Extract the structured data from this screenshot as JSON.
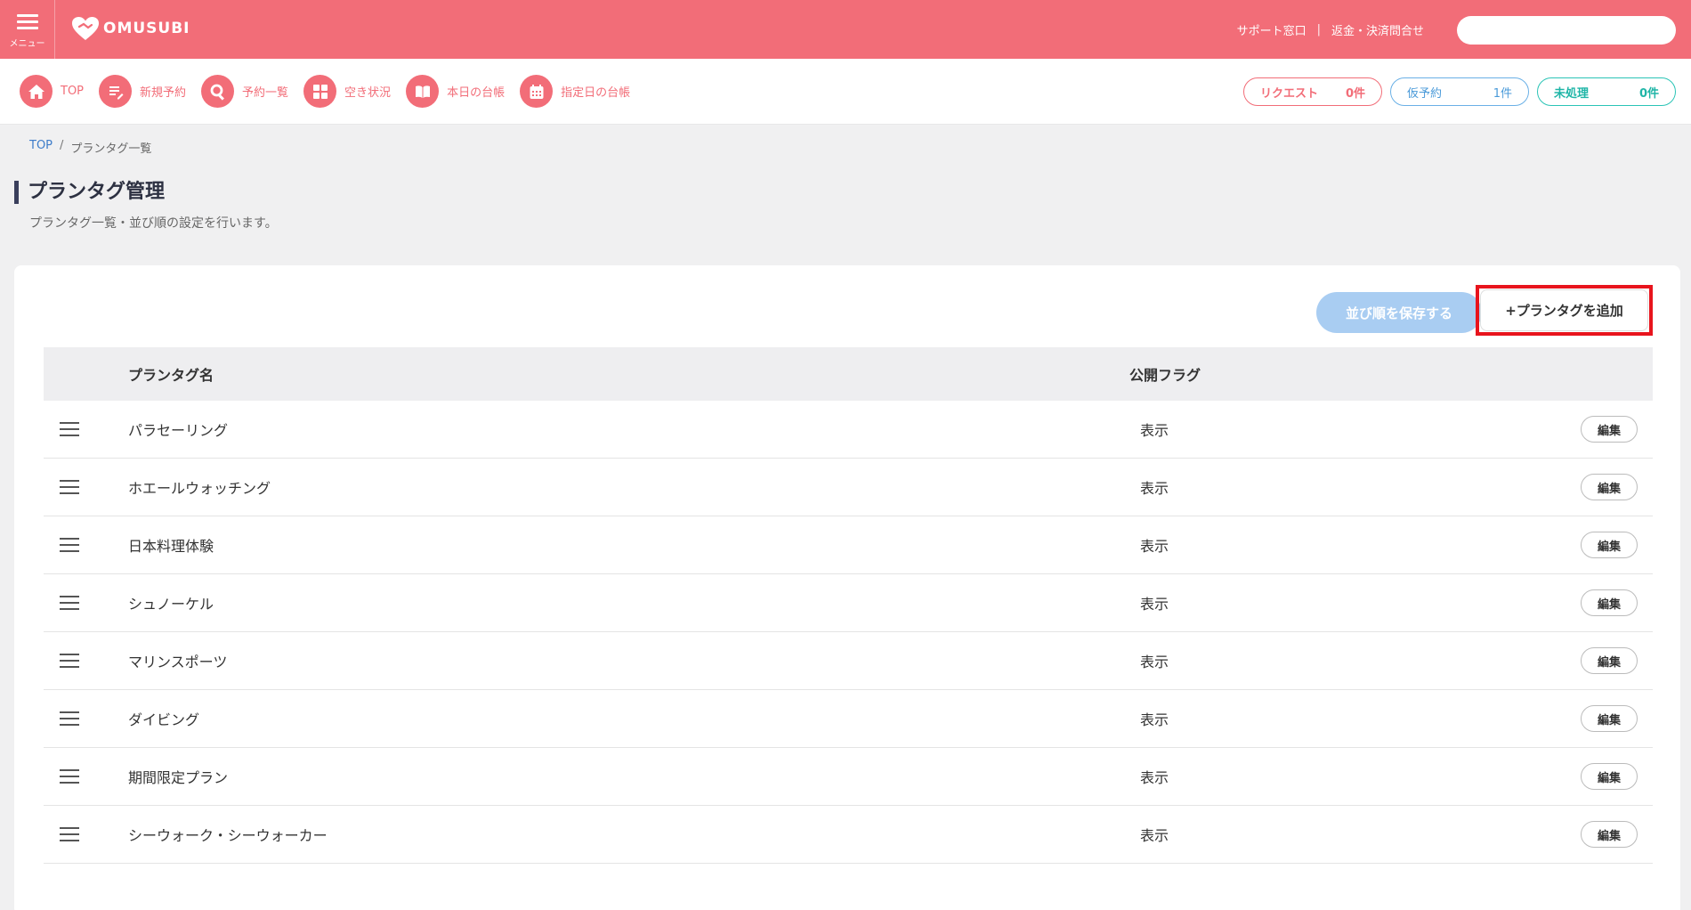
{
  "header": {
    "menu_label": "メニュー",
    "logo_text": "OMUSUBI",
    "links": [
      "サポート窓口",
      "返金・決済問合せ"
    ],
    "link_separator": "|",
    "search_placeholder": "",
    "brand_color": "#f26d78"
  },
  "nav": {
    "items": [
      {
        "label": "TOP",
        "icon": "home-icon"
      },
      {
        "label": "新規予約",
        "icon": "edit-icon"
      },
      {
        "label": "予約一覧",
        "icon": "search-icon"
      },
      {
        "label": "空き状況",
        "icon": "grid-icon"
      },
      {
        "label": "本日の台帳",
        "icon": "book-icon"
      },
      {
        "label": "指定日の台帳",
        "icon": "calendar-icon"
      }
    ],
    "status": [
      {
        "label": "リクエスト",
        "count": "0件",
        "color": "#f26d78"
      },
      {
        "label": "仮予約",
        "count": "1件",
        "color": "#4a9ad9"
      },
      {
        "label": "未処理",
        "count": "0件",
        "color": "#1fb5a7"
      }
    ]
  },
  "breadcrumb": {
    "home": "TOP",
    "separator": "/",
    "current": "プランタグ一覧"
  },
  "page": {
    "title": "プランタグ管理",
    "description": "プランタグ一覧・並び順の設定を行います。"
  },
  "actions": {
    "save_order": "並び順を保存する",
    "add_tag": "+プランタグを追加"
  },
  "table": {
    "headers": {
      "name": "プランタグ名",
      "flag": "公開フラグ"
    },
    "edit_label": "編集",
    "rows": [
      {
        "name": "パラセーリング",
        "flag": "表示"
      },
      {
        "name": "ホエールウォッチング",
        "flag": "表示"
      },
      {
        "name": "日本料理体験",
        "flag": "表示"
      },
      {
        "name": "シュノーケル",
        "flag": "表示"
      },
      {
        "name": "マリンスポーツ",
        "flag": "表示"
      },
      {
        "name": "ダイビング",
        "flag": "表示"
      },
      {
        "name": "期間限定プラン",
        "flag": "表示"
      },
      {
        "name": "シーウォーク・シーウォーカー",
        "flag": "表示"
      }
    ]
  }
}
